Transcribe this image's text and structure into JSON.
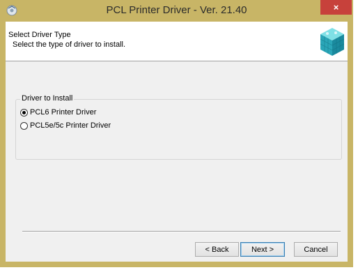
{
  "window": {
    "title": "PCL Printer Driver - Ver. 21.40",
    "close_label": "×"
  },
  "header": {
    "title": "Select Driver Type",
    "subtitle": "Select the type of driver to install."
  },
  "group": {
    "legend": "Driver to Install",
    "options": [
      {
        "label": "PCL6 Printer Driver",
        "selected": true
      },
      {
        "label": "PCL5e/5c Printer Driver",
        "selected": false
      }
    ]
  },
  "buttons": {
    "back": "< Back",
    "next": "Next >",
    "cancel": "Cancel"
  },
  "colors": {
    "frame": "#c8b566",
    "close": "#c7413b",
    "accent": "#3c7fb1"
  },
  "icons": {
    "app": "printer-driver-disc-icon",
    "header": "teal-cube-icon"
  }
}
